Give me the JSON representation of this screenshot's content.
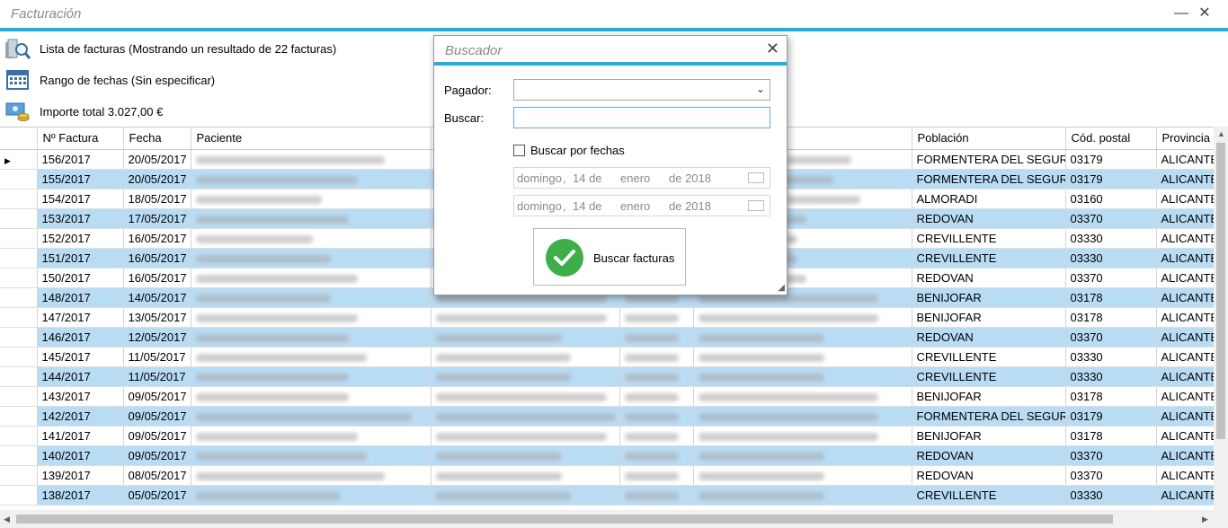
{
  "window": {
    "title": "Facturación"
  },
  "info": {
    "list_text": "Lista de facturas (Mostrando un resultado de 22 facturas)",
    "date_range_text": "Rango de fechas (Sin especificar)",
    "total_text": "Importe total 3.027,00 €"
  },
  "table": {
    "columns": [
      "Nº Factura",
      "Fecha",
      "Paciente",
      "",
      "",
      "",
      "Población",
      "Cód. postal",
      "Provincia"
    ],
    "rows": [
      [
        "156/2017",
        "20/05/2017",
        "FORMENTERA DEL SEGURA",
        "03179",
        "ALICANTE"
      ],
      [
        "155/2017",
        "20/05/2017",
        "FORMENTERA DEL SEGURA",
        "03179",
        "ALICANTE"
      ],
      [
        "154/2017",
        "18/05/2017",
        "ALMORADI",
        "03160",
        "ALICANTE"
      ],
      [
        "153/2017",
        "17/05/2017",
        "REDOVAN",
        "03370",
        "ALICANTE"
      ],
      [
        "152/2017",
        "16/05/2017",
        "CREVILLENTE",
        "03330",
        "ALICANTE"
      ],
      [
        "151/2017",
        "16/05/2017",
        "CREVILLENTE",
        "03330",
        "ALICANTE"
      ],
      [
        "150/2017",
        "16/05/2017",
        "REDOVAN",
        "03370",
        "ALICANTE"
      ],
      [
        "148/2017",
        "14/05/2017",
        "BENIJOFAR",
        "03178",
        "ALICANTE"
      ],
      [
        "147/2017",
        "13/05/2017",
        "BENIJOFAR",
        "03178",
        "ALICANTE"
      ],
      [
        "146/2017",
        "12/05/2017",
        "REDOVAN",
        "03370",
        "ALICANTE"
      ],
      [
        "145/2017",
        "11/05/2017",
        "CREVILLENTE",
        "03330",
        "ALICANTE"
      ],
      [
        "144/2017",
        "11/05/2017",
        "CREVILLENTE",
        "03330",
        "ALICANTE"
      ],
      [
        "143/2017",
        "09/05/2017",
        "BENIJOFAR",
        "03178",
        "ALICANTE"
      ],
      [
        "142/2017",
        "09/05/2017",
        "FORMENTERA DEL SEGURA",
        "03179",
        "ALICANTE"
      ],
      [
        "141/2017",
        "09/05/2017",
        "BENIJOFAR",
        "03178",
        "ALICANTE"
      ],
      [
        "140/2017",
        "09/05/2017",
        "REDOVAN",
        "03370",
        "ALICANTE"
      ],
      [
        "139/2017",
        "08/05/2017",
        "REDOVAN",
        "03370",
        "ALICANTE"
      ],
      [
        "138/2017",
        "05/05/2017",
        "CREVILLENTE",
        "03330",
        "ALICANTE"
      ]
    ]
  },
  "dialog": {
    "title": "Buscador",
    "payer_label": "Pagador:",
    "payer_value": "",
    "search_label": "Buscar:",
    "search_value": "",
    "date_checkbox_label": "Buscar por fechas",
    "date_from": {
      "weekday": "domingo",
      "day": "14 de",
      "month": "enero",
      "year": "de 2018"
    },
    "date_to": {
      "weekday": "domingo",
      "day": "14 de",
      "month": "enero",
      "year": "de 2018"
    },
    "submit_label": "Buscar facturas"
  },
  "colors": {
    "accent": "#1fb0e0",
    "row_alt": "#b9dcf5",
    "ok_green": "#3dae49"
  }
}
